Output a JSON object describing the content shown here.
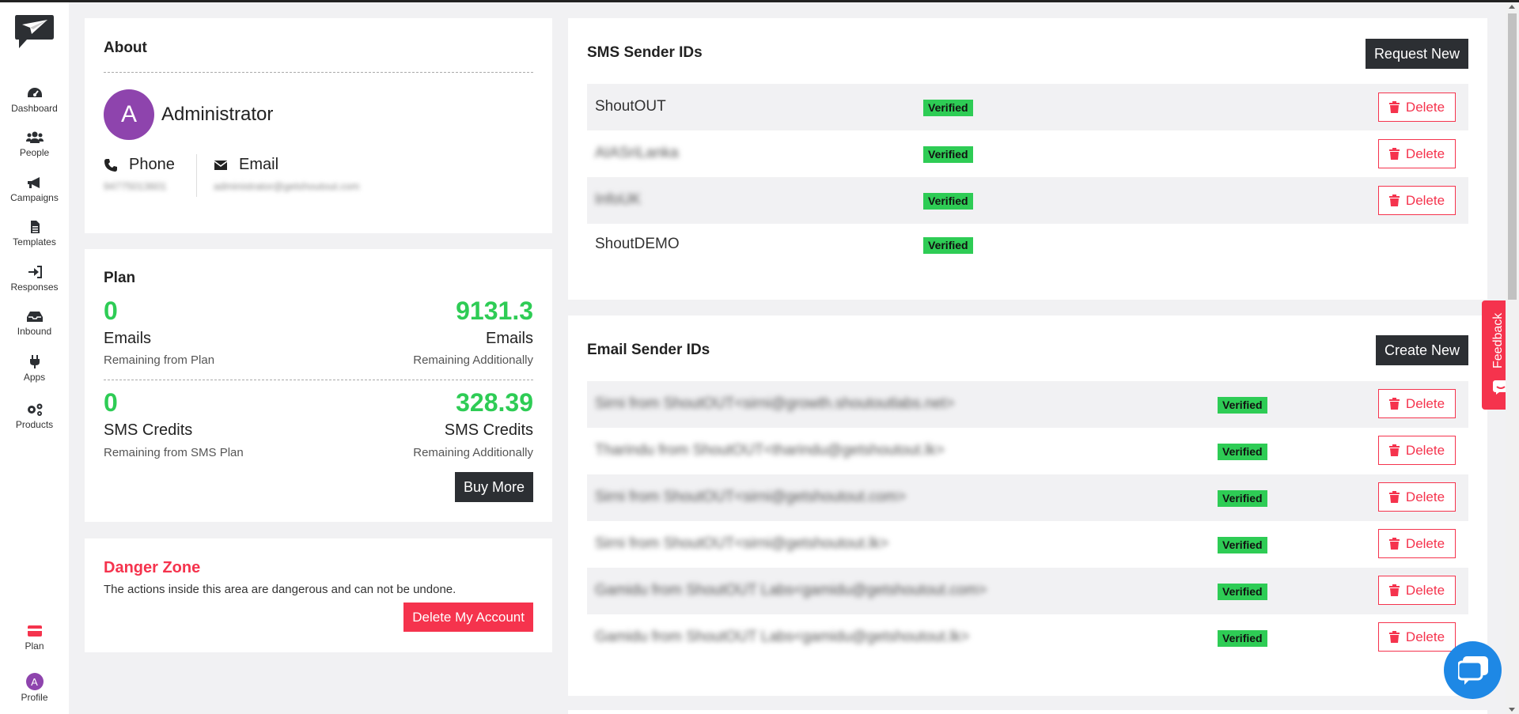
{
  "colors": {
    "accent_green": "#2ecc55",
    "danger": "#f5334d",
    "dark_button": "#2c2f33",
    "avatar": "#8e44ad",
    "chat": "#1e88e5"
  },
  "sidebar": {
    "items": [
      {
        "label": "Dashboard",
        "icon": "dashboard-icon"
      },
      {
        "label": "People",
        "icon": "people-icon"
      },
      {
        "label": "Campaigns",
        "icon": "megaphone-icon"
      },
      {
        "label": "Templates",
        "icon": "document-icon"
      },
      {
        "label": "Responses",
        "icon": "sign-in-icon"
      },
      {
        "label": "Inbound",
        "icon": "inbox-icon"
      },
      {
        "label": "Apps",
        "icon": "plug-icon"
      },
      {
        "label": "Products",
        "icon": "gears-icon"
      }
    ],
    "plan_label": "Plan",
    "profile_label": "Profile",
    "profile_initial": "A"
  },
  "about": {
    "title": "About",
    "avatar_initial": "A",
    "name": "Administrator",
    "phone_label": "Phone",
    "phone_value": "94775013601",
    "email_label": "Email",
    "email_value": "administrator@getshoutout.com"
  },
  "plan": {
    "title": "Plan",
    "emails_plan_value": "0",
    "emails_plan_unit": "Emails",
    "emails_plan_caption": "Remaining from Plan",
    "emails_add_value": "9131.3",
    "emails_add_unit": "Emails",
    "emails_add_caption": "Remaining Additionally",
    "sms_plan_value": "0",
    "sms_plan_unit": "SMS Credits",
    "sms_plan_caption": "Remaining from SMS Plan",
    "sms_add_value": "328.39",
    "sms_add_unit": "SMS Credits",
    "sms_add_caption": "Remaining Additionally",
    "buy_more": "Buy More"
  },
  "danger": {
    "title": "Danger Zone",
    "description": "The actions inside this area are dangerous and can not be undone.",
    "delete_account": "Delete My Account"
  },
  "sms_senders": {
    "title": "SMS Sender IDs",
    "request_new": "Request New",
    "rows": [
      {
        "name": "ShoutOUT",
        "status": "Verified",
        "delete": "Delete"
      },
      {
        "name": "AIASriLanka",
        "status": "Verified",
        "delete": "Delete"
      },
      {
        "name": "InfoUK",
        "status": "Verified",
        "delete": "Delete"
      },
      {
        "name": "ShoutDEMO",
        "status": "Verified"
      }
    ]
  },
  "email_senders": {
    "title": "Email Sender IDs",
    "create_new": "Create New",
    "rows": [
      {
        "name": "Sirni from ShoutOUT<sirni@growth.shoutoutlabs.net>",
        "status": "Verified",
        "delete": "Delete"
      },
      {
        "name": "Tharindu from ShoutOUT<tharindu@getshoutout.lk>",
        "status": "Verified",
        "delete": "Delete"
      },
      {
        "name": "Sirni from ShoutOUT<sirni@getshoutout.com>",
        "status": "Verified",
        "delete": "Delete"
      },
      {
        "name": "Sirni from ShoutOUT<sirni@getshoutout.lk>",
        "status": "Verified",
        "delete": "Delete"
      },
      {
        "name": "Gamidu from ShoutOUT Labs<gamidu@getshoutout.com>",
        "status": "Verified",
        "delete": "Delete"
      },
      {
        "name": "Gamidu from ShoutOUT Labs<gamidu@getshoutout.lk>",
        "status": "Verified",
        "delete": "Delete"
      }
    ]
  },
  "feedback": {
    "label": "Feedback"
  }
}
